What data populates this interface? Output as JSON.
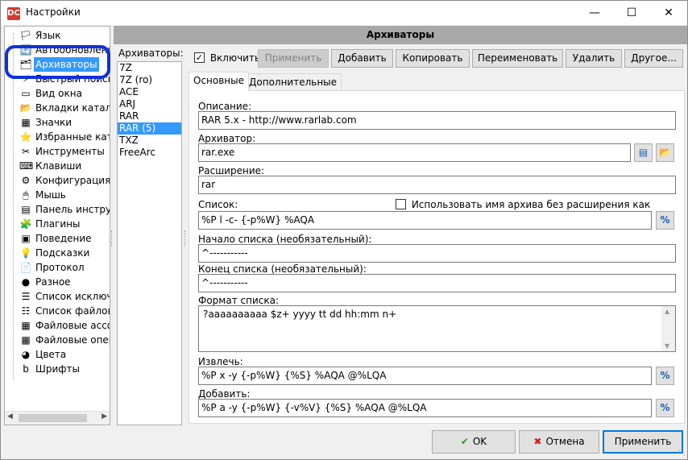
{
  "window": {
    "title": "Настройки",
    "icon": "dc-app-icon"
  },
  "tree": {
    "items": [
      {
        "label": "Язык",
        "icon": "flag-icon",
        "glyph": "🏳"
      },
      {
        "label": "Автообновление",
        "icon": "refresh-icon",
        "glyph": "🔄"
      },
      {
        "label": "Архиваторы",
        "icon": "archive-icon",
        "glyph": "🗂",
        "selected": true
      },
      {
        "label": "Быстрый поиск/фильтр",
        "icon": "search-filter-icon",
        "glyph": "⚡"
      },
      {
        "label": "Вид окна",
        "icon": "window-view-icon",
        "glyph": "▭"
      },
      {
        "label": "Вкладки каталогов",
        "icon": "folder-tabs-icon",
        "glyph": "📂"
      },
      {
        "label": "Значки",
        "icon": "icons-icon",
        "glyph": "▦"
      },
      {
        "label": "Избранные каталоги",
        "icon": "favorites-icon",
        "glyph": "⭐"
      },
      {
        "label": "Инструменты",
        "icon": "tools-icon",
        "glyph": "✂"
      },
      {
        "label": "Клавиши",
        "icon": "keyboard-icon",
        "glyph": "⌨"
      },
      {
        "label": "Конфигурация",
        "icon": "config-icon",
        "glyph": "⚙"
      },
      {
        "label": "Мышь",
        "icon": "mouse-icon",
        "glyph": "🖱"
      },
      {
        "label": "Панель инструментов",
        "icon": "toolbar-icon",
        "glyph": "▤"
      },
      {
        "label": "Плагины",
        "icon": "plugins-icon",
        "glyph": "🧩"
      },
      {
        "label": "Поведение",
        "icon": "behavior-icon",
        "glyph": "▣"
      },
      {
        "label": "Подсказки",
        "icon": "tooltips-icon",
        "glyph": "💡"
      },
      {
        "label": "Протокол",
        "icon": "log-icon",
        "glyph": "📄"
      },
      {
        "label": "Разное",
        "icon": "misc-icon",
        "glyph": "●"
      },
      {
        "label": "Список исключений",
        "icon": "exclusions-icon",
        "glyph": "☰"
      },
      {
        "label": "Список файлов",
        "icon": "file-list-icon",
        "glyph": "☷"
      },
      {
        "label": "Файловые ассоциации",
        "icon": "file-assoc-icon",
        "glyph": "▦"
      },
      {
        "label": "Файловые операции",
        "icon": "file-ops-icon",
        "glyph": "▦"
      },
      {
        "label": "Цвета",
        "icon": "colors-icon",
        "glyph": "◕"
      },
      {
        "label": "Шрифты",
        "icon": "fonts-icon",
        "glyph": "b"
      }
    ]
  },
  "header": {
    "title": "Архиваторы"
  },
  "archivers": {
    "label": "Архиваторы:",
    "items": [
      "7Z",
      "7Z (ro)",
      "ACE",
      "ARJ",
      "RAR",
      "RAR (5)",
      "TXZ",
      "FreeArc"
    ],
    "selected_index": 5
  },
  "toolbar": {
    "enable_label": "Включить",
    "enable_checked": true,
    "apply": "Применить",
    "add": "Добавить",
    "copy": "Копировать",
    "rename": "Переименовать",
    "delete": "Удалить",
    "other": "Другое..."
  },
  "tabs": {
    "basic": "Основные",
    "advanced": "Дополнительные"
  },
  "form": {
    "description_label": "Описание:",
    "description_value": "RAR 5.x - http://www.rarlab.com",
    "archiver_label": "Архиватор:",
    "archiver_value": "rar.exe",
    "extension_label": "Расширение:",
    "extension_value": "rar",
    "list_label": "Список:",
    "list_value": "%P l -c- {-p%W} %AQA",
    "use_name_label": "Использовать имя архива без расширения как список",
    "use_name_checked": false,
    "list_start_label": "Начало списка (необязательный):",
    "list_start_value": "^-----------",
    "list_end_label": "Конец списка (необязательный):",
    "list_end_value": "^-----------",
    "list_format_label": "Формат списка:",
    "list_format_value": "?aaaaaaaaaa $z+  yyyy tt dd hh:mm  n+",
    "extract_label": "Извлечь:",
    "extract_value": "%P x -y {-p%W} {%S} %AQA @%LQA",
    "add_label": "Добавить:",
    "add_value": "%P a -y {-p%W} {-v%V} {%S} %AQA @%LQA",
    "percent_glyph": "%"
  },
  "buttons": {
    "ok": "OK",
    "cancel": "Отмена",
    "apply": "Применить"
  }
}
